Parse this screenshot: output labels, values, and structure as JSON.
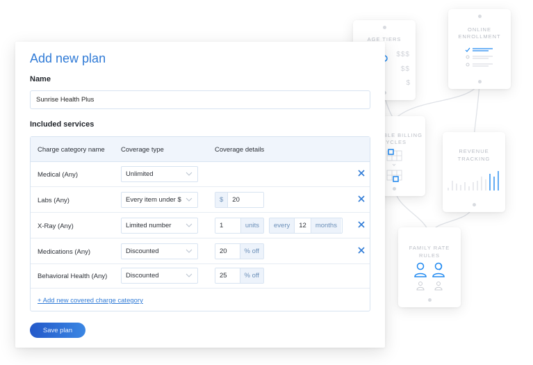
{
  "main": {
    "title": "Add new plan",
    "name_label": "Name",
    "name_value": "Sunrise Health Plus",
    "services_label": "Included services",
    "table": {
      "headers": [
        "Charge category name",
        "Coverage type",
        "Coverage details"
      ],
      "rows": [
        {
          "name": "Medical (Any)",
          "type": "Unlimited",
          "details": [],
          "removable": true
        },
        {
          "name": "Labs (Any)",
          "type": "Every item under $",
          "details": [
            {
              "prefix": "$",
              "value": "20"
            }
          ],
          "removable": true
        },
        {
          "name": "X-Ray (Any)",
          "type": "Limited number",
          "details": [
            {
              "value": "1",
              "suffix": "units"
            },
            {
              "prefix": "every",
              "value": "12",
              "suffix": "months"
            }
          ],
          "removable": true
        },
        {
          "name": "Medications (Any)",
          "type": "Discounted",
          "details": [
            {
              "value": "20",
              "suffix": "% off"
            }
          ],
          "removable": true
        },
        {
          "name": "Behavioral Health (Any)",
          "type": "Discounted",
          "details": [
            {
              "value": "25",
              "suffix": "% off"
            }
          ],
          "removable": false
        }
      ],
      "add_link": "+ Add new covered charge category"
    },
    "save_label": "Save plan"
  },
  "feature_cards": {
    "age_tiers": {
      "title": "AGE TIERS",
      "price_levels": [
        "$$$",
        "$$",
        "$"
      ]
    },
    "online_enrollment": {
      "title_line1": "ONLINE",
      "title_line2": "ENROLLMENT"
    },
    "flexible_billing": {
      "title_line1": "FLEXIBLE BILLING",
      "title_line2": "CYCLES"
    },
    "revenue_tracking": {
      "title_line1": "REVENUE",
      "title_line2": "TRACKING"
    },
    "family_rate": {
      "title_line1": "FAMILY RATE",
      "title_line2": "RULES"
    }
  },
  "colors": {
    "accent": "#2f7ad6",
    "button": "#2c6ad6",
    "icon_active": "#1e88f0",
    "muted": "#c9ccd3"
  }
}
